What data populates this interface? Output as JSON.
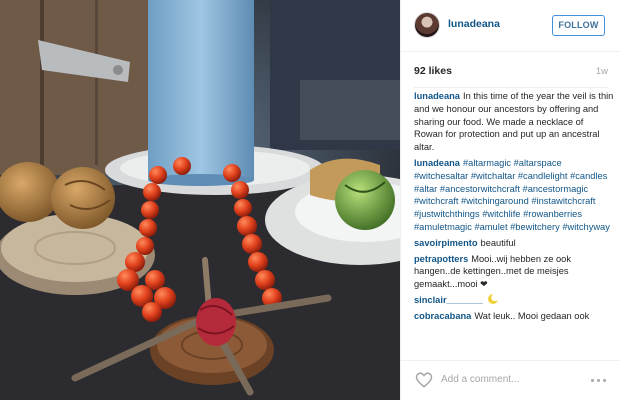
{
  "post": {
    "username": "lunadeana",
    "follow_label": "FOLLOW",
    "likes": "92 likes",
    "age": "1w",
    "photo_alt": "Photo by lunadeana"
  },
  "caption": {
    "author": "lunadeana",
    "text": "In this time of the year the veil is thin and we honour our ancestors by offering and sharing our food. We made a necklace of Rowan for protection and put up an ancestral altar."
  },
  "hashtag_comment": {
    "author": "lunadeana",
    "tags": [
      "#altarmagic",
      "#altarspace",
      "#witchesaltar",
      "#witchaltar",
      "#candlelight",
      "#candles",
      "#altar",
      "#ancestorwitchcraft",
      "#ancestormagic",
      "#witchcraft",
      "#witchingaround",
      "#instawitchcraft",
      "#justwitchthings",
      "#witchlife",
      "#rowanberries",
      "#amuletmagic",
      "#amulet",
      "#bewitchery",
      "#witchyway"
    ]
  },
  "comments": [
    {
      "author": "savoirpimento",
      "text": "beautiful"
    },
    {
      "author": "petrapotters",
      "text": "Mooi..wij hebben ze ook hangen..de kettingen..met de meisjes gemaakt...mooi"
    },
    {
      "author": "sinclair_______",
      "text": ""
    },
    {
      "author": "cobracabana",
      "text": "Wat leuk.. Mooi gedaan ook"
    }
  ],
  "footer": {
    "add_comment_placeholder": "Add a comment..."
  },
  "icons": {
    "like": "heart-outline-icon",
    "more": "more-options-icon",
    "emoji_heart": "heart-emoji",
    "emoji_moon": "crescent-moon-emoji"
  },
  "colors": {
    "link_blue": "#125688",
    "follow_border": "#4090db",
    "follow_text": "#3f729b",
    "muted_gray": "#a5a7aa"
  }
}
